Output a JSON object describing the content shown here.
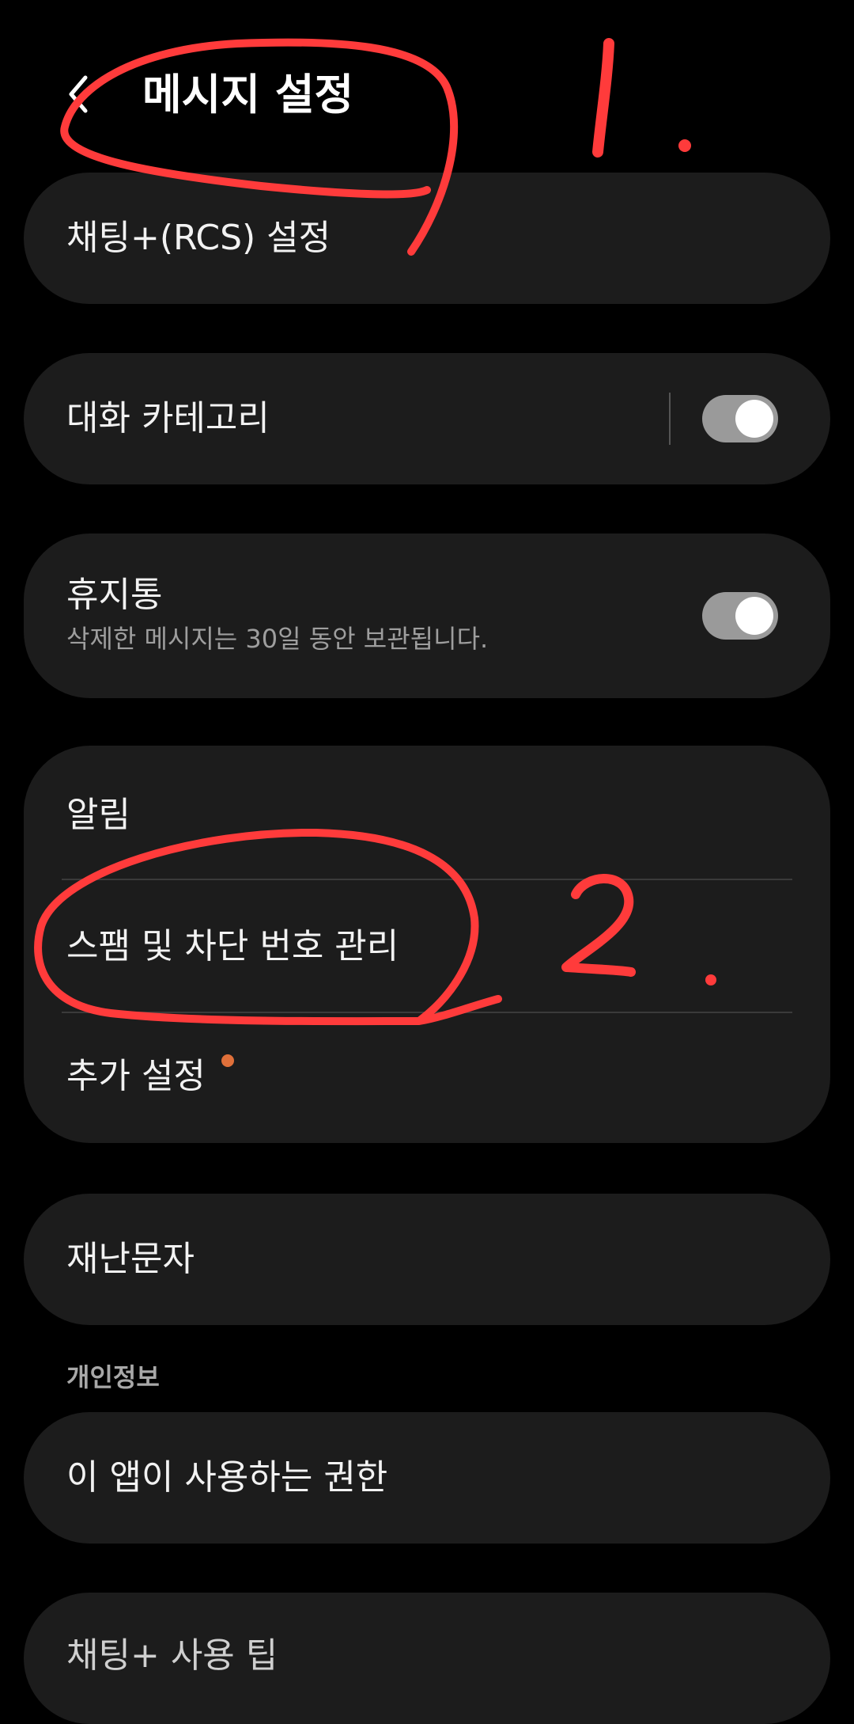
{
  "header": {
    "title": "메시지 설정",
    "back_icon": "chevron-left-icon"
  },
  "items": {
    "chat_rcs": {
      "label": "채팅+(RCS) 설정"
    },
    "conversation_categories": {
      "label": "대화 카테고리",
      "toggle_on": true
    },
    "trash": {
      "label": "휴지통",
      "description": "삭제한 메시지는 30일 동안 보관됩니다.",
      "toggle_on": true
    },
    "notifications": {
      "label": "알림"
    },
    "spam_block": {
      "label": "스팸 및 차단 번호 관리"
    },
    "more_settings": {
      "label": "추가 설정",
      "badge_color": "#e0703a"
    },
    "emergency_alerts": {
      "label": "재난문자"
    }
  },
  "privacy": {
    "section_title": "개인정보",
    "permissions": {
      "label": "이 앱이 사용하는 권한"
    }
  },
  "partial_item": {
    "label": "채팅+ 사용 팁"
  },
  "annotations": {
    "marker_1": "1.",
    "marker_2": "2.",
    "color": "#ff3b3b"
  },
  "colors": {
    "background": "#000000",
    "card": "#1c1c1c",
    "toggle_track": "#9a9a9a"
  }
}
